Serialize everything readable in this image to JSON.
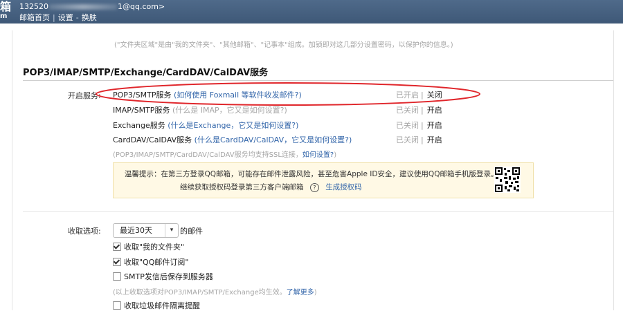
{
  "header": {
    "logo": "箱",
    "logo_sub": "m",
    "account_prefix": "132520",
    "account_suffix": "1@qq.com>",
    "nav": [
      "邮箱首页",
      "设置",
      "换肤"
    ]
  },
  "description": "(\"文件夹区域\"是由\"我的文件夹\"、\"其他邮箱\"、\"记事本\"组成。加锁即对这几部分设置密码，以保护你的信息。)",
  "section_title": "POP3/IMAP/SMTP/Exchange/CardDAV/CalDAV服务",
  "enable_label": "开启服务:",
  "services": [
    {
      "name": "POP3/SMTP服务",
      "help": "(如何使用 Foxmail 等软件收发邮件?)",
      "status": "已开启",
      "action": "关闭"
    },
    {
      "name": "IMAP/SMTP服务",
      "help": "(什么是 IMAP，它又是如何设置?)",
      "status": "已关闭",
      "action": "开启"
    },
    {
      "name": "Exchange服务",
      "help": "(什么是Exchange，它又是如何设置?)",
      "status": "已关闭",
      "action": "开启"
    },
    {
      "name": "CardDAV/CalDAV服务",
      "help": "(什么是CardDAV/CalDAV，它又是如何设置?)",
      "status": "已关闭",
      "action": "开启"
    }
  ],
  "ssl_note": "(POP3/IMAP/SMTP/CardDAV/CalDAV服务均支持SSL连接，",
  "ssl_link": "如何设置?",
  "ssl_note_end": ")",
  "warning": {
    "line1": "温馨提示：在第三方登录QQ邮箱，可能存在邮件泄露风险，甚至危害Apple ID安全，建议使用QQ邮箱手机版登录。",
    "line2": "继续获取授权码登录第三方客户端邮箱",
    "help_icon": "?",
    "link": "生成授权码"
  },
  "receive": {
    "label": "收取选项:",
    "selected": "最近30天",
    "suffix": "的邮件",
    "options": [
      {
        "label": "收取\"我的文件夹\"",
        "checked": true
      },
      {
        "label": "收取\"QQ邮件订阅\"",
        "checked": true
      },
      {
        "label": "SMTP发信后保存到服务器",
        "checked": false
      }
    ],
    "note": "(以上收取选项对POP3/IMAP/SMTP/Exchange均生效。",
    "note_link": "了解更多",
    "note_end": ")",
    "last_option": {
      "label": "收取垃圾邮件隔离提醒",
      "checked": false
    }
  },
  "colors": {
    "header_bg": "#4a6587",
    "link": "#3366aa",
    "highlight_ellipse": "#e0262b",
    "warning_bg": "#fff9e5"
  }
}
